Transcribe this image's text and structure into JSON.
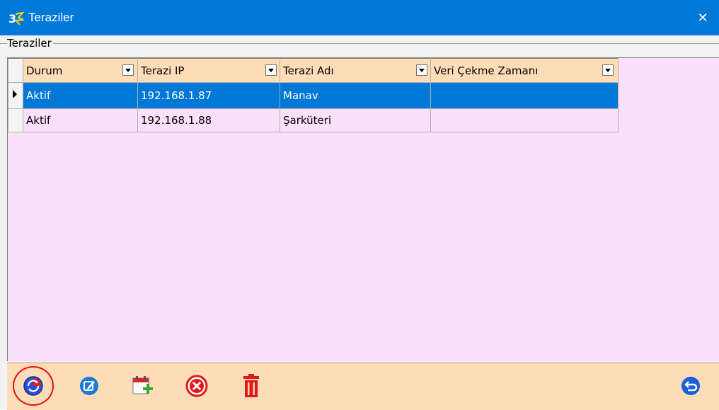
{
  "window": {
    "title": "Teraziler",
    "close_glyph": "✕"
  },
  "group": {
    "label": "Teraziler"
  },
  "grid": {
    "columns": [
      "Durum",
      "Terazi IP",
      "Terazi Adı",
      "Veri Çekme Zamanı"
    ],
    "rows": [
      {
        "selected": true,
        "cells": [
          "Aktif",
          "192.168.1.87",
          "Manav",
          ""
        ]
      },
      {
        "selected": false,
        "cells": [
          "Aktif",
          "192.168.1.88",
          "Şarküteri",
          ""
        ]
      }
    ]
  },
  "toolbar": {
    "buttons": [
      "refresh-icon",
      "edit-icon",
      "add-calendar-icon",
      "cancel-icon",
      "delete-icon",
      "back-icon"
    ]
  },
  "colors": {
    "title_bar": "#0078d7",
    "grid_bg": "#fbe0fb",
    "header_bg": "#fddcb8",
    "selection": "#0078d7",
    "toolbar_bg": "#fddcb8"
  }
}
